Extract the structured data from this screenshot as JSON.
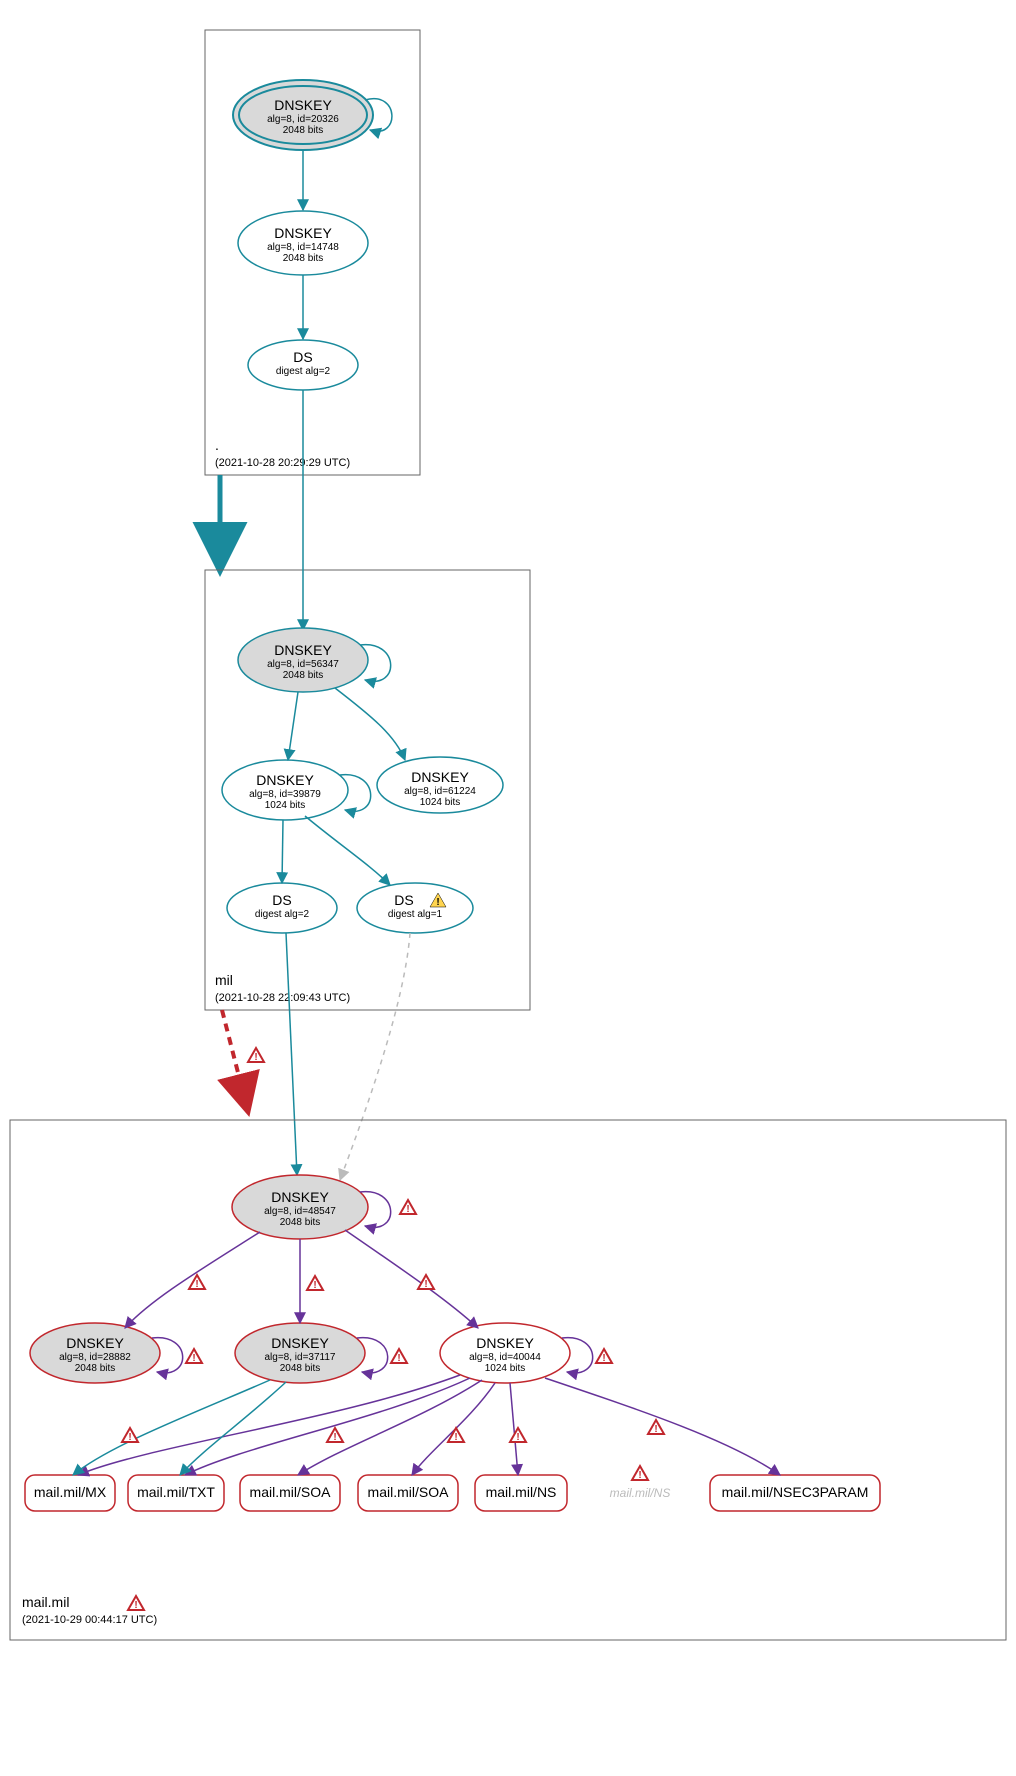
{
  "zones": {
    "root": {
      "label": ".",
      "timestamp": "(2021-10-28 20:29:29 UTC)"
    },
    "mil": {
      "label": "mil",
      "timestamp": "(2021-10-28 22:09:43 UTC)"
    },
    "mailmil": {
      "label": "mail.mil",
      "timestamp": "(2021-10-29 00:44:17 UTC)"
    }
  },
  "nodes": {
    "root_ksk": {
      "title": "DNSKEY",
      "sub1": "alg=8, id=20326",
      "sub2": "2048 bits"
    },
    "root_zsk": {
      "title": "DNSKEY",
      "sub1": "alg=8, id=14748",
      "sub2": "2048 bits"
    },
    "root_ds": {
      "title": "DS",
      "sub1": "digest alg=2"
    },
    "mil_ksk": {
      "title": "DNSKEY",
      "sub1": "alg=8, id=56347",
      "sub2": "2048 bits"
    },
    "mil_zsk": {
      "title": "DNSKEY",
      "sub1": "alg=8, id=39879",
      "sub2": "1024 bits"
    },
    "mil_zsk2": {
      "title": "DNSKEY",
      "sub1": "alg=8, id=61224",
      "sub2": "1024 bits"
    },
    "mil_ds1": {
      "title": "DS",
      "sub1": "digest alg=2"
    },
    "mil_ds2": {
      "title": "DS",
      "sub1": "digest alg=1"
    },
    "mm_ksk": {
      "title": "DNSKEY",
      "sub1": "alg=8, id=48547",
      "sub2": "2048 bits"
    },
    "mm_k1": {
      "title": "DNSKEY",
      "sub1": "alg=8, id=28882",
      "sub2": "2048 bits"
    },
    "mm_k2": {
      "title": "DNSKEY",
      "sub1": "alg=8, id=37117",
      "sub2": "2048 bits"
    },
    "mm_k3": {
      "title": "DNSKEY",
      "sub1": "alg=8, id=40044",
      "sub2": "1024 bits"
    },
    "rr_mx": {
      "title": "mail.mil/MX"
    },
    "rr_txt": {
      "title": "mail.mil/TXT"
    },
    "rr_soa1": {
      "title": "mail.mil/SOA"
    },
    "rr_soa2": {
      "title": "mail.mil/SOA"
    },
    "rr_ns": {
      "title": "mail.mil/NS"
    },
    "rr_ns2": {
      "title": "mail.mil/NS"
    },
    "rr_nsec3": {
      "title": "mail.mil/NSEC3PARAM"
    }
  },
  "icons": {
    "warn_yellow": "warning-yellow-icon",
    "warn_red": "warning-red-icon"
  }
}
